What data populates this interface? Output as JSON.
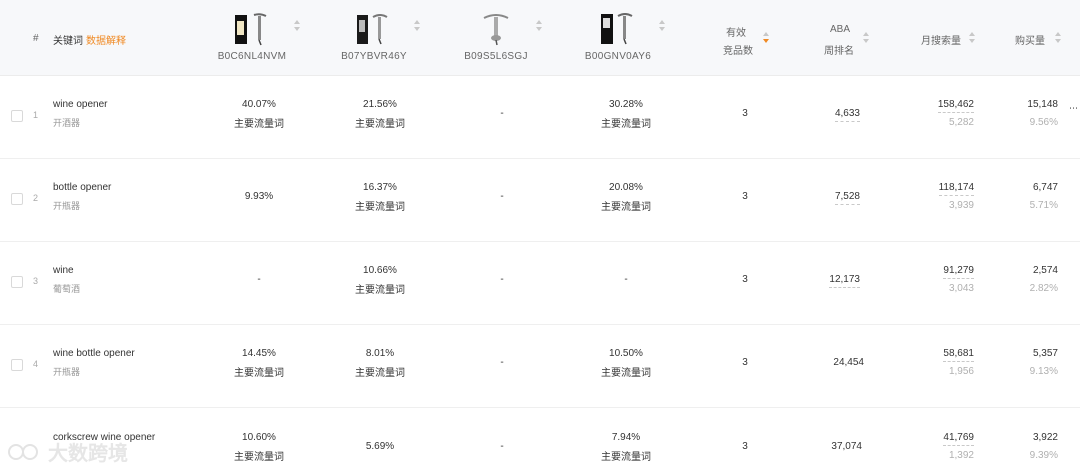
{
  "header": {
    "index_label": "#",
    "keyword_label": "关键词",
    "data_explain_link": "数据解释",
    "asins": [
      "B0C6NL4NVM",
      "B07YBVR46Y",
      "B09S5L6SGJ",
      "B00GNV0AY6"
    ],
    "effective_products_line1": "有效",
    "effective_products_line2": "竞品数",
    "aba_line1": "ABA",
    "aba_line2": "周排名",
    "monthly_search_label": "月搜索量",
    "purchase_label": "购买量"
  },
  "rows": [
    {
      "index": "1",
      "keyword": "wine opener",
      "keyword_cn": "开酒器",
      "asin1_pct": "40.07%",
      "asin1_tag": "主要流量词",
      "asin2_pct": "21.56%",
      "asin2_tag": "主要流量词",
      "asin3_pct": "-",
      "asin3_tag": "",
      "asin4_pct": "30.28%",
      "asin4_tag": "主要流量词",
      "competitors": "3",
      "aba_rank": "4,633",
      "monthly_search": "158,462",
      "monthly_search_sub": "5,282",
      "purchases": "15,148",
      "purchase_rate": "9.56%"
    },
    {
      "index": "2",
      "keyword": "bottle opener",
      "keyword_cn": "开瓶器",
      "asin1_pct": "9.93%",
      "asin1_tag": "",
      "asin2_pct": "16.37%",
      "asin2_tag": "主要流量词",
      "asin3_pct": "-",
      "asin3_tag": "",
      "asin4_pct": "20.08%",
      "asin4_tag": "主要流量词",
      "competitors": "3",
      "aba_rank": "7,528",
      "monthly_search": "118,174",
      "monthly_search_sub": "3,939",
      "purchases": "6,747",
      "purchase_rate": "5.71%"
    },
    {
      "index": "3",
      "keyword": "wine",
      "keyword_cn": "葡萄酒",
      "asin1_pct": "-",
      "asin1_tag": "",
      "asin2_pct": "10.66%",
      "asin2_tag": "主要流量词",
      "asin3_pct": "-",
      "asin3_tag": "",
      "asin4_pct": "-",
      "asin4_tag": "",
      "competitors": "3",
      "aba_rank": "12,173",
      "monthly_search": "91,279",
      "monthly_search_sub": "3,043",
      "purchases": "2,574",
      "purchase_rate": "2.82%"
    },
    {
      "index": "4",
      "keyword": "wine bottle opener",
      "keyword_cn": "开瓶器",
      "asin1_pct": "14.45%",
      "asin1_tag": "主要流量词",
      "asin2_pct": "8.01%",
      "asin2_tag": "主要流量词",
      "asin3_pct": "-",
      "asin3_tag": "",
      "asin4_pct": "10.50%",
      "asin4_tag": "主要流量词",
      "competitors": "3",
      "aba_rank": "24,454",
      "monthly_search": "58,681",
      "monthly_search_sub": "1,956",
      "purchases": "5,357",
      "purchase_rate": "9.13%"
    },
    {
      "index": "",
      "keyword": "corkscrew wine opener",
      "keyword_cn": "",
      "asin1_pct": "10.60%",
      "asin1_tag": "主要流量词",
      "asin2_pct": "5.69%",
      "asin2_tag": "",
      "asin3_pct": "-",
      "asin3_tag": "",
      "asin4_pct": "7.94%",
      "asin4_tag": "主要流量词",
      "competitors": "3",
      "aba_rank": "37,074",
      "monthly_search": "41,769",
      "monthly_search_sub": "1,392",
      "purchases": "3,922",
      "purchase_rate": "9.39%"
    }
  ],
  "watermark": "大数跨境",
  "colors": {
    "accent": "#f08a24",
    "header_bg": "#f7f8fa",
    "muted": "#b0b0b0"
  }
}
